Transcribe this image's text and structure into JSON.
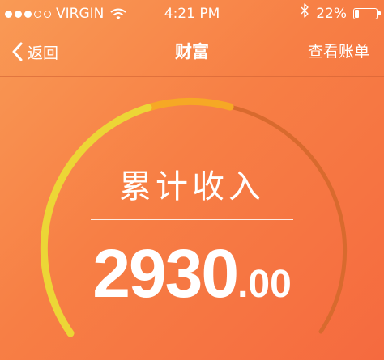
{
  "status_bar": {
    "carrier": "VIRGIN",
    "time": "4:21 PM",
    "battery_text": "22%",
    "battery_level": 0.22,
    "signal_strength": 3,
    "signal_max": 5
  },
  "nav": {
    "back_label": "返回",
    "title": "财富",
    "right_label": "查看账单"
  },
  "gauge": {
    "label": "累计收入",
    "amount_int": "2930",
    "amount_dec": ".00"
  },
  "colors": {
    "background_start": "#f99a55",
    "background_end": "#f56a3f",
    "arc_yellow": "#ecd636",
    "arc_amber": "#f6a825",
    "arc_track": "#d86a2e",
    "text": "#ffffff"
  }
}
